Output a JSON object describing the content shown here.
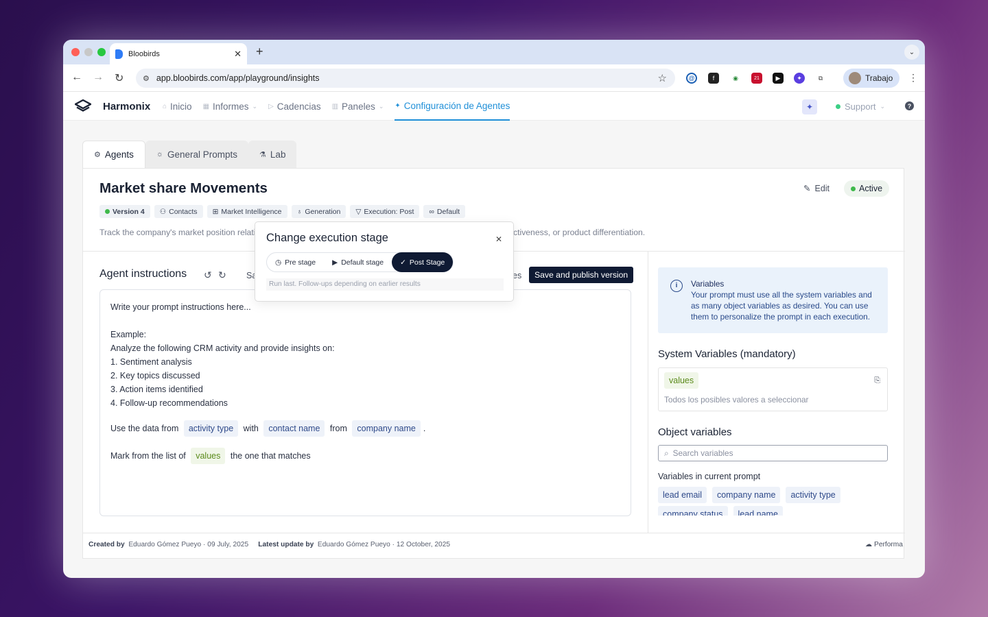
{
  "browser": {
    "tab_title": "Bloobirds",
    "url": "app.bloobirds.com/app/playground/insights",
    "profile_name": "Trabajo",
    "extension_badge": "21"
  },
  "app": {
    "brand": "Harmonix",
    "nav": [
      {
        "label": "Inicio"
      },
      {
        "label": "Informes"
      },
      {
        "label": "Cadencias"
      },
      {
        "label": "Paneles"
      },
      {
        "label": "Configuración de Agentes"
      }
    ],
    "support_label": "Support",
    "help_label": "?"
  },
  "tabs": [
    {
      "label": "Agents"
    },
    {
      "label": "General Prompts"
    },
    {
      "label": "Lab"
    }
  ],
  "agent": {
    "title": "Market share Movements",
    "edit_label": "Edit",
    "status_label": "Active",
    "chips": [
      {
        "label": "Version 4"
      },
      {
        "label": "Contacts"
      },
      {
        "label": "Market Intelligence"
      },
      {
        "label": "Generation"
      },
      {
        "label": "Execution: Post"
      },
      {
        "label": "Default"
      }
    ],
    "description_left": "Track the company's market position relati",
    "description_right": "ctiveness, or product differentiation."
  },
  "instructions": {
    "title": "Agent instructions",
    "sa_fragment": "Sa",
    "es_fragment": "es",
    "publish_label": "Save and publish version",
    "lines": [
      "Write your prompt instructions here...",
      "",
      "Example:",
      "Analyze the following CRM activity and provide insights on:",
      "1. Sentiment analysis",
      "2. Key topics discussed",
      "3. Action items identified",
      "4. Follow-up recommendations"
    ],
    "line_use_data": {
      "prefix": "Use the data from",
      "var1": "activity type",
      "mid1": "with",
      "var2": "contact name",
      "mid2": "from",
      "var3": "company name",
      "suffix": "."
    },
    "line_mark": {
      "prefix": "Mark from the list of",
      "var": "values",
      "suffix": "the one that matches"
    }
  },
  "sidebar": {
    "info_title": "Variables",
    "info_text": "Your prompt must use all the system variables and as many object variables as desired. You can use them to personalize the prompt in each execution.",
    "system_title": "System Variables (mandatory)",
    "system_var": "values",
    "system_var_desc": "Todos los posibles valores a seleccionar",
    "object_title": "Object variables",
    "search_placeholder": "Search variables",
    "current_label": "Variables in current prompt",
    "current_vars": [
      "lead email",
      "company name",
      "activity type",
      "company status",
      "lead name"
    ]
  },
  "footer": {
    "created_label": "Created by",
    "created_value": "Eduardo Gómez Pueyo · 09 July, 2025",
    "updated_label": "Latest update by",
    "updated_value": "Eduardo Gómez Pueyo · 12 October, 2025",
    "performance_label": "Performa"
  },
  "popover": {
    "title": "Change execution stage",
    "options": [
      {
        "label": "Pre stage"
      },
      {
        "label": "Default stage"
      },
      {
        "label": "Post Stage"
      }
    ],
    "selected_index": 2,
    "hint": "Run last. Follow-ups depending on earlier results"
  }
}
